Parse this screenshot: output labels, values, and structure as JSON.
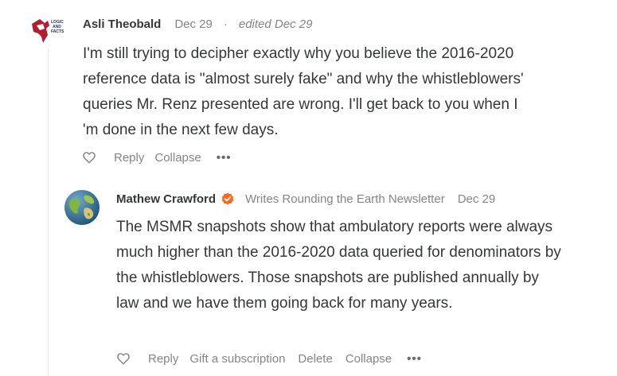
{
  "comment1": {
    "author": "Asli Theobald",
    "date": "Dec 29",
    "separator": "·",
    "edited": "edited Dec 29",
    "body": "I'm still trying to decipher exactly why you believe the 2016-2020 reference data is \"almost surely fake\" and why the whistleblowers' queries Mr. Renz presented are wrong. I'll get back to you when I 'm done in the next few days.",
    "logo_text": "LOGIC AND FACTS",
    "actions": {
      "reply": "Reply",
      "collapse": "Collapse",
      "more": "•••"
    }
  },
  "comment2": {
    "author": "Mathew Crawford",
    "subtitle": "Writes Rounding the Earth Newsletter",
    "date": "Dec 29",
    "body": "The MSMR snapshots show that ambulatory reports were always much higher than the 2016-2020 data queried for denominators by the whistleblowers. Those snapshots are published annually by law and we have them going back for many years.",
    "actions": {
      "reply": "Reply",
      "gift": "Gift a subscription",
      "delete": "Delete",
      "collapse": "Collapse",
      "more": "•••"
    }
  },
  "colors": {
    "text": "#363737",
    "meta": "#858585",
    "badge": "#ff6719",
    "thread_line": "#e6e6e6"
  }
}
